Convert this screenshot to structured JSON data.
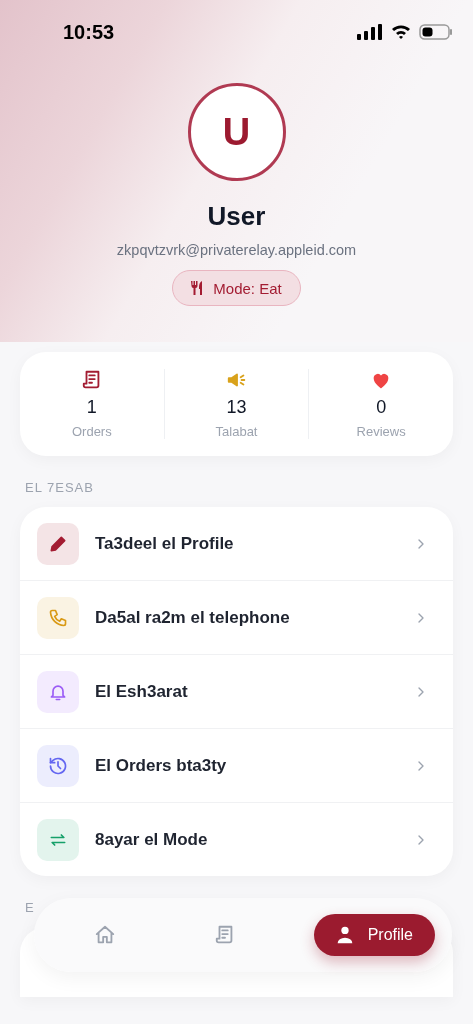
{
  "status_bar": {
    "time": "10:53"
  },
  "profile": {
    "initial": "U",
    "name": "User",
    "email": "zkpqvtzvrk@privaterelay.appleid.com",
    "mode": "Mode: Eat"
  },
  "stats": [
    {
      "kind": "orders",
      "value": "1",
      "label": "Orders",
      "color": "#a31c32"
    },
    {
      "kind": "talabat",
      "value": "13",
      "label": "Talabat",
      "color": "#d9a21b"
    },
    {
      "kind": "reviews",
      "value": "0",
      "label": "Reviews",
      "color": "#ef4444"
    }
  ],
  "sections": [
    {
      "title": "EL 7ESAB",
      "items": [
        {
          "kind": "edit",
          "label": "Ta3deel el Profile",
          "color": "#a31c32"
        },
        {
          "kind": "phone",
          "label": "Da5al ra2m el telephone",
          "color": "#d99a16"
        },
        {
          "kind": "bell",
          "label": "El Esh3arat",
          "color": "#9b5cf6"
        },
        {
          "kind": "history",
          "label": "El Orders bta3ty",
          "color": "#6366f1"
        },
        {
          "kind": "swap",
          "label": "8ayar el Mode",
          "color": "#16a06a"
        }
      ]
    },
    {
      "title": "E"
    }
  ],
  "nav": [
    {
      "kind": "home",
      "selected": false
    },
    {
      "kind": "orders",
      "selected": false
    },
    {
      "kind": "profile",
      "label": "Profile",
      "selected": true
    }
  ]
}
